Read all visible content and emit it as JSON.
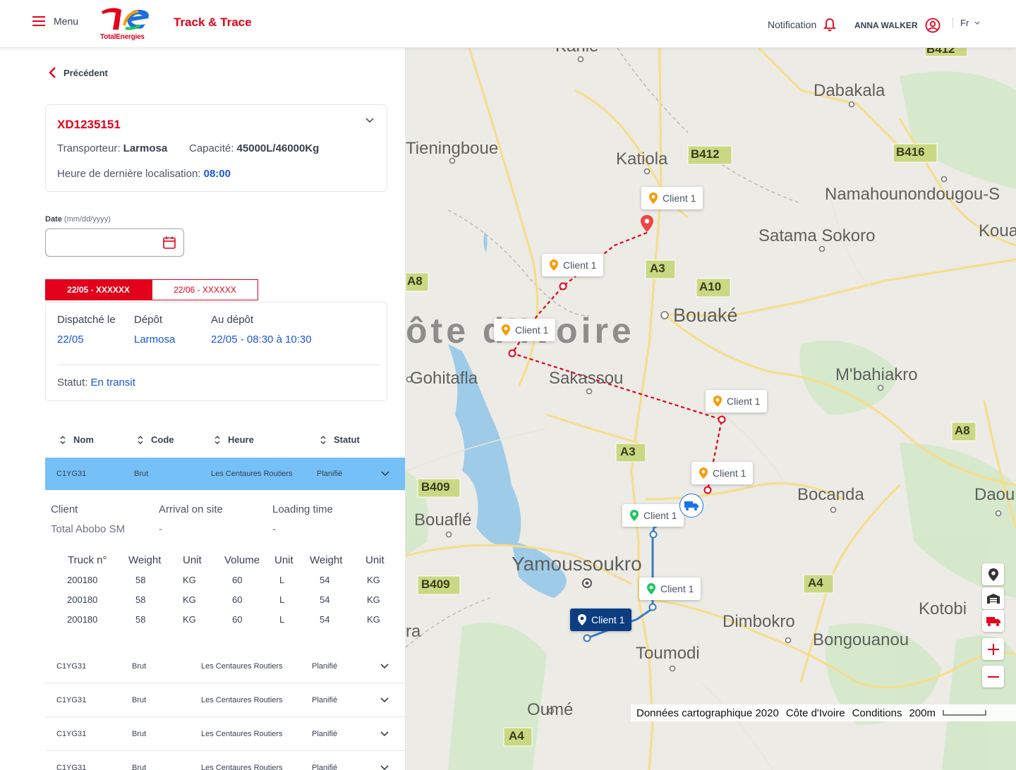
{
  "header": {
    "menu_label": "Menu",
    "brand_text": "TotalEnergies",
    "app_title": "Track & Trace",
    "notification_label": "Notification",
    "user_name": "ANNA WALKER",
    "language": "Fr",
    "brand_color": "#e3001b"
  },
  "nav": {
    "back_label": "Précédent"
  },
  "shipment": {
    "reference": "XD1235151",
    "carrier_label": "Transporteur:",
    "carrier_value": "Larmosa",
    "capacity_label": "Capacité:",
    "capacity_value": "45000L/46000Kg",
    "last_location_label": "Heure de dernière localisation:",
    "last_location_value": "08:00"
  },
  "date_filter": {
    "label": "Date",
    "hint": "(mm/dd/yyyy)",
    "value": ""
  },
  "tabs": [
    {
      "label": "22/05 - XXXXXX",
      "active": true
    },
    {
      "label": "22/06 - XXXXXX",
      "active": false
    }
  ],
  "dispatch": {
    "dispatched_label": "Dispatché le",
    "dispatched_value": "22/05",
    "depot_label": "Dépôt",
    "depot_value": "Larmosa",
    "at_depot_label": "Au dépôt",
    "at_depot_value": "22/05 - 08:30 à 10:30",
    "status_label": "Statut:",
    "status_value": "En transit"
  },
  "table": {
    "headers": [
      "Nom",
      "Code",
      "Heure",
      "Statut"
    ],
    "selected_row": {
      "nom": "C1YG31",
      "code": "Brut",
      "heure": "Les Centaures Routiers",
      "statut": "Planifié"
    },
    "detail": {
      "client_label": "Client",
      "client_value": "Total Abobo SM",
      "arrival_label": "Arrival on site",
      "arrival_value": "-",
      "loading_label": "Loading time",
      "loading_value": "-",
      "truck_headers": [
        "Truck n°",
        "Weight",
        "Unit",
        "Volume",
        "Unit",
        "Weight",
        "Unit"
      ],
      "truck_rows": [
        [
          "200180",
          "58",
          "KG",
          "60",
          "L",
          "54",
          "KG"
        ],
        [
          "200180",
          "58",
          "KG",
          "60",
          "L",
          "54",
          "KG"
        ],
        [
          "200180",
          "58",
          "KG",
          "60",
          "L",
          "54",
          "KG"
        ]
      ]
    },
    "rows": [
      {
        "nom": "C1YG31",
        "code": "Brut",
        "heure": "Les Centaures Routiers",
        "statut": "Planifié"
      },
      {
        "nom": "C1YG31",
        "code": "Brut",
        "heure": "Les Centaures Routiers",
        "statut": "Planifié"
      },
      {
        "nom": "C1YG31",
        "code": "Brut",
        "heure": "Les Centaures Routiers",
        "statut": "Planifié"
      },
      {
        "nom": "C1YG31",
        "code": "Brut",
        "heure": "Les Centaures Routiers",
        "statut": "Planifié"
      }
    ]
  },
  "map": {
    "places": [
      "Kaniè",
      "B412",
      "Dabakala",
      "Tieningboue",
      "Katiola",
      "B412",
      "B416",
      "Namahounondougou-S",
      "Satama Sokoro",
      "Koua",
      "A8",
      "A3",
      "A10",
      "Bouaké",
      "ôte d'Ivoire",
      "Gohitafla",
      "Sakassou",
      "M'bahiakro",
      "A8",
      "A3",
      "B409",
      "Bocanda",
      "Daouk",
      "Bouaflé",
      "Yamoussoukro",
      "B409",
      "A4",
      "Kotobi",
      "ra",
      "Dimbokro",
      "Bongouanou",
      "Toumodi",
      "Oumé",
      "A4",
      "A"
    ],
    "client_label": "Client 1",
    "attribution": [
      "Données cartographique 2020",
      "Côte d'Ivoire",
      "Conditions",
      "200m"
    ],
    "colors": {
      "planned_route": "#e3001b",
      "done_route": "#3b7bbf",
      "pin_orange": "#f59e0b",
      "pin_green": "#22c55e",
      "selected_label": "#0b3d80"
    }
  }
}
